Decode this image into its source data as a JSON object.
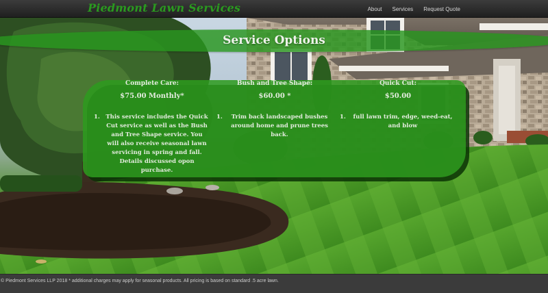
{
  "navbar": {
    "brand": "Piedmont Lawn Services",
    "links": [
      "About",
      "Services",
      "Request Quote"
    ]
  },
  "banner": {
    "title": "Service Options"
  },
  "options": [
    {
      "title": "Complete Care:",
      "price": "$75.00 Monthly*",
      "items": [
        {
          "num": "1.",
          "lines": [
            "This service includes the Quick",
            "Cut service as well as the Bush",
            "and Tree Shape service. You",
            "will also receive seasonal lawn",
            "servicing in spring and fall.",
            "Details discussed opon",
            "purchase."
          ]
        }
      ]
    },
    {
      "title": "Bush and Tree Shape:",
      "price": "$60.00 *",
      "items": [
        {
          "num": "1.",
          "lines": [
            "Trim back landscaped bushes",
            "around home and prune trees",
            "back."
          ]
        }
      ]
    },
    {
      "title": "Quick Cut:",
      "price": "$50.00",
      "items": [
        {
          "num": "1.",
          "lines": [
            "full lawn trim, edge, weed-eat,",
            "and blow"
          ]
        }
      ]
    }
  ],
  "footer": {
    "text": "© Piedmont Services LLP 2018 * additional charges may apply for seasonal products. All pricing is based on standard .5 acre lawn."
  },
  "colors": {
    "brand_green": "#2a9a1f",
    "panel_green": "#2d9b1e",
    "navbar_bg": "#2a2a2a",
    "footer_bg": "#3b3b3b",
    "text_light": "#e4ecdf"
  },
  "background_image": "house-with-lawn-photo"
}
